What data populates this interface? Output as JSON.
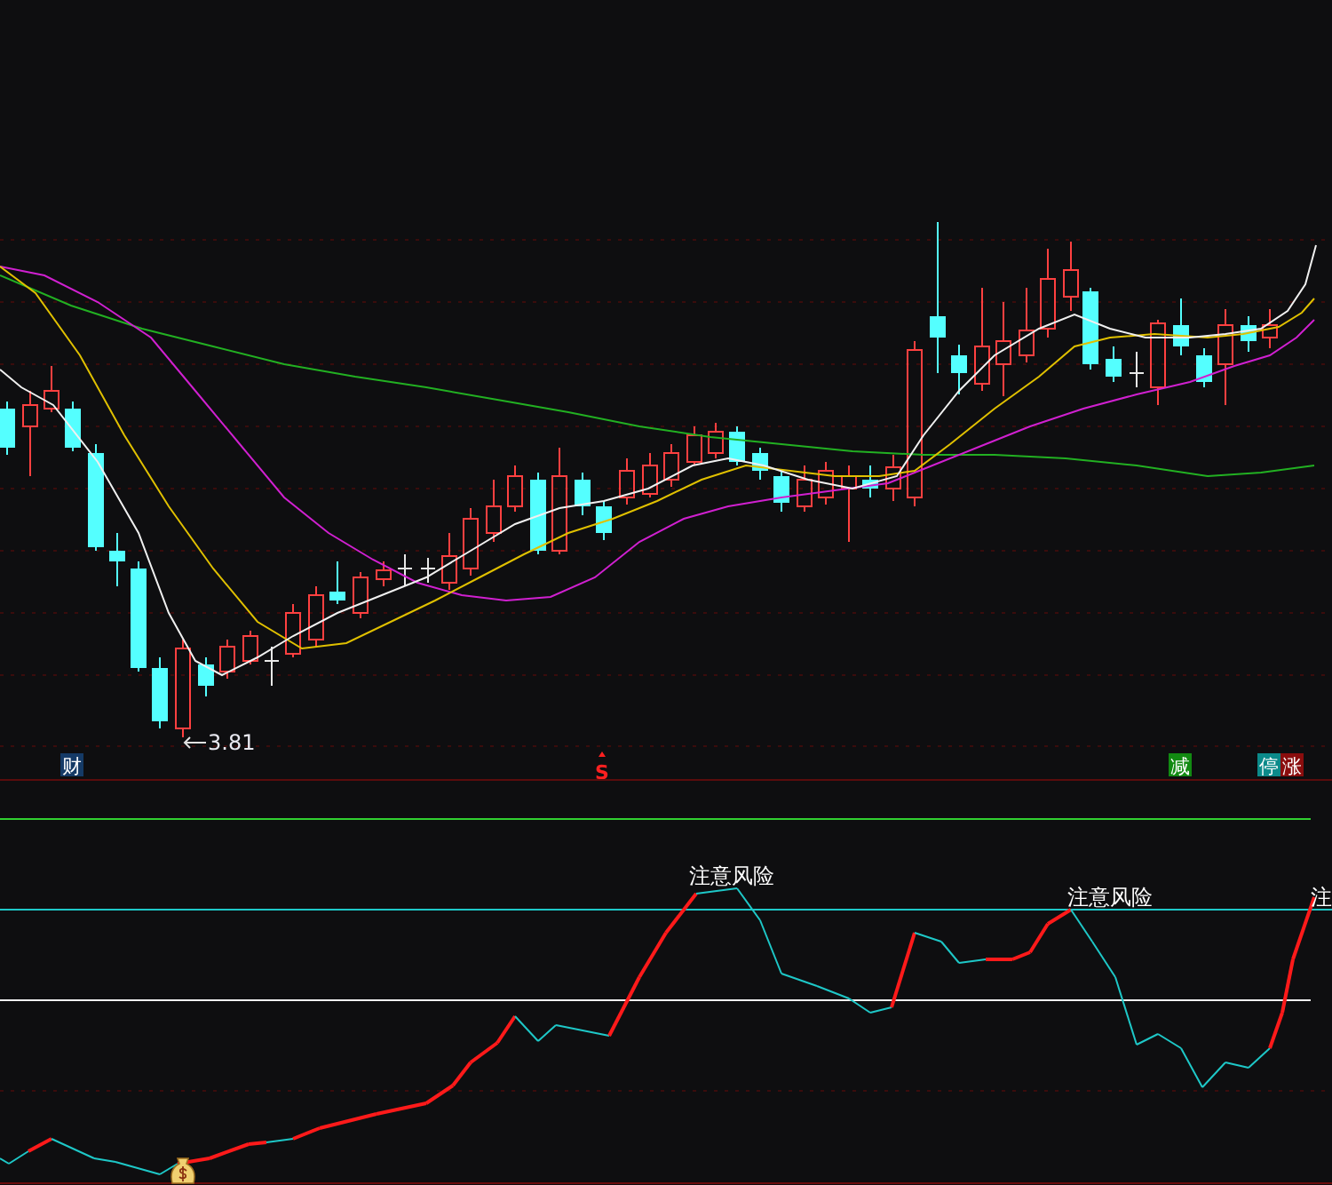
{
  "main_chart": {
    "price_label": "3.81",
    "markers": [
      {
        "text": "财",
        "kind": "tag",
        "color": "#153a66"
      },
      {
        "text": "S",
        "kind": "letter",
        "color": "#ff2020"
      },
      {
        "text": "减",
        "kind": "tag",
        "color": "#128a12"
      },
      {
        "text": "停",
        "kind": "tag",
        "color": "#0b8a8a"
      },
      {
        "text": "涨",
        "kind": "tag",
        "color": "#8a0d0d"
      }
    ]
  },
  "indicator": {
    "warnings": [
      "注意风险",
      "注意风险",
      "注"
    ]
  }
}
